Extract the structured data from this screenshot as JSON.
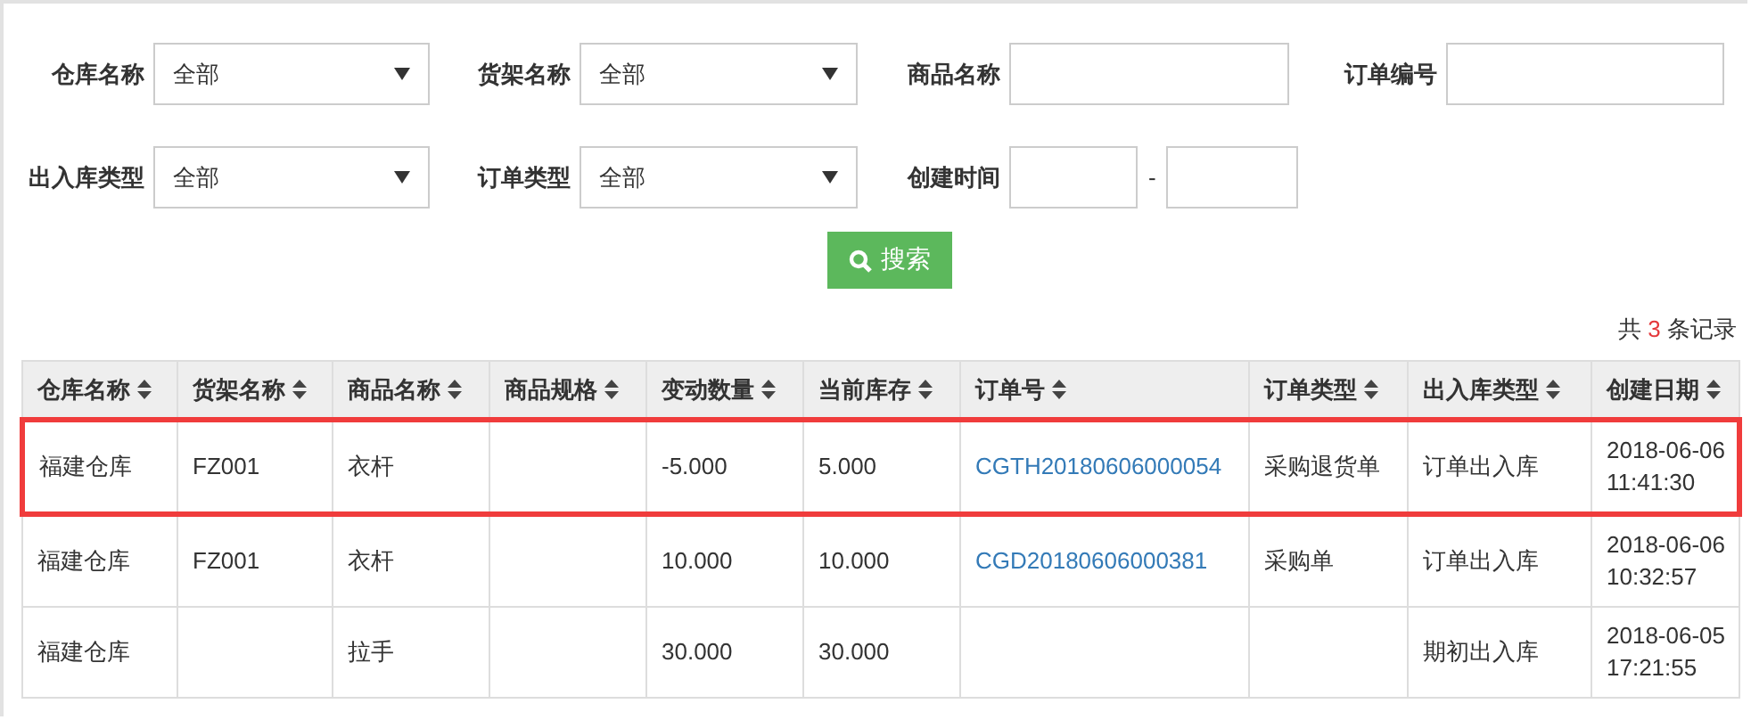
{
  "filters": [
    {
      "label": "仓库名称",
      "kind": "select",
      "value": "全部"
    },
    {
      "label": "货架名称",
      "kind": "select",
      "value": "全部"
    },
    {
      "label": "商品名称",
      "kind": "input"
    },
    {
      "label": "订单编号",
      "kind": "input"
    },
    {
      "label": "出入库类型",
      "kind": "select",
      "value": "全部"
    },
    {
      "label": "订单类型",
      "kind": "select",
      "value": "全部"
    },
    {
      "label": "创建时间",
      "kind": "date_range",
      "separator": "-"
    }
  ],
  "search_button": {
    "label": "搜索"
  },
  "record_count": {
    "prefix": "共",
    "count": "3",
    "suffix": "条记录"
  },
  "table": {
    "columns": [
      {
        "label": "仓库名称"
      },
      {
        "label": "货架名称"
      },
      {
        "label": "商品名称"
      },
      {
        "label": "商品规格"
      },
      {
        "label": "变动数量"
      },
      {
        "label": "当前库存"
      },
      {
        "label": "订单号",
        "kind": "link"
      },
      {
        "label": "订单类型"
      },
      {
        "label": "出入库类型"
      },
      {
        "label": "创建日期"
      }
    ],
    "rows": [
      {
        "highlighted": true,
        "cells": [
          "福建仓库",
          "FZ001",
          "衣杆",
          "",
          "-5.000",
          "5.000",
          "CGTH20180606000054",
          "采购退货单",
          "订单出入库",
          "2018-06-06 11:41:30"
        ]
      },
      {
        "highlighted": false,
        "cells": [
          "福建仓库",
          "FZ001",
          "衣杆",
          "",
          "10.000",
          "10.000",
          "CGD20180606000381",
          "采购单",
          "订单出入库",
          "2018-06-06 10:32:57"
        ]
      },
      {
        "highlighted": false,
        "cells": [
          "福建仓库",
          "",
          "拉手",
          "",
          "30.000",
          "30.000",
          "",
          "",
          "期初出入库",
          "2018-06-05 17:21:55"
        ]
      }
    ]
  }
}
